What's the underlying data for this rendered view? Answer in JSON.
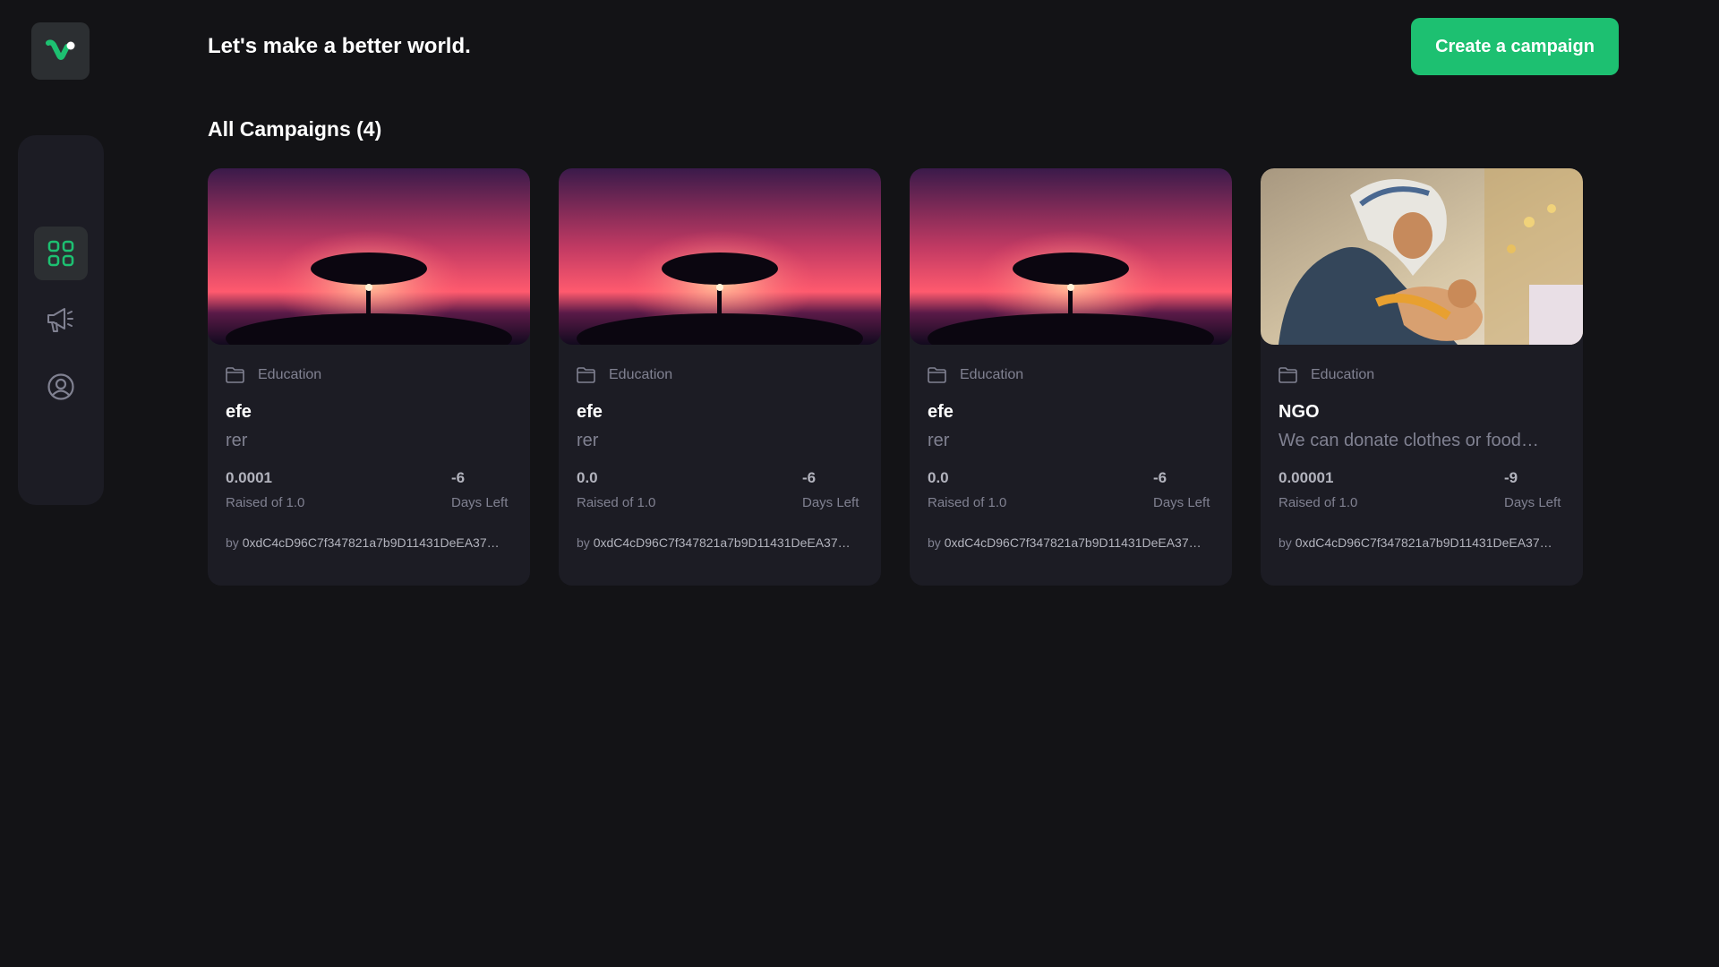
{
  "header": {
    "tagline": "Let's make a better world.",
    "create_button_label": "Create a campaign"
  },
  "sidebar": {
    "items": [
      {
        "name": "dashboard",
        "icon": "dashboard-grid-icon",
        "active": true
      },
      {
        "name": "campaign",
        "icon": "megaphone-icon",
        "active": false
      },
      {
        "name": "profile",
        "icon": "user-circle-icon",
        "active": false
      }
    ]
  },
  "logo": {
    "icon": "app-logo-icon"
  },
  "section": {
    "title": "All Campaigns (4)"
  },
  "colors": {
    "accent": "#1dc071",
    "background": "#131316",
    "card": "#1c1c24",
    "muted_text": "#808191"
  },
  "campaigns": [
    {
      "category": "Education",
      "title": "efe",
      "description": "rer",
      "raised": "0.0001",
      "raised_label": "Raised of 1.0",
      "days": "-6",
      "days_label": "Days Left",
      "owner_prefix": "by",
      "owner": "0xdC4cD96C7f347821a7b9D11431DeEA37…",
      "image": "sunset-tree-image"
    },
    {
      "category": "Education",
      "title": "efe",
      "description": "rer",
      "raised": "0.0",
      "raised_label": "Raised of 1.0",
      "days": "-6",
      "days_label": "Days Left",
      "owner_prefix": "by",
      "owner": "0xdC4cD96C7f347821a7b9D11431DeEA37…",
      "image": "sunset-tree-image"
    },
    {
      "category": "Education",
      "title": "efe",
      "description": "rer",
      "raised": "0.0",
      "raised_label": "Raised of 1.0",
      "days": "-6",
      "days_label": "Days Left",
      "owner_prefix": "by",
      "owner": "0xdC4cD96C7f347821a7b9D11431DeEA37…",
      "image": "sunset-tree-image"
    },
    {
      "category": "Education",
      "title": "NGO",
      "description": "We can donate clothes or food…",
      "raised": "0.00001",
      "raised_label": "Raised of 1.0",
      "days": "-9",
      "days_label": "Days Left",
      "owner_prefix": "by",
      "owner": "0xdC4cD96C7f347821a7b9D11431DeEA37…",
      "image": "nun-with-child-statue-image"
    }
  ]
}
